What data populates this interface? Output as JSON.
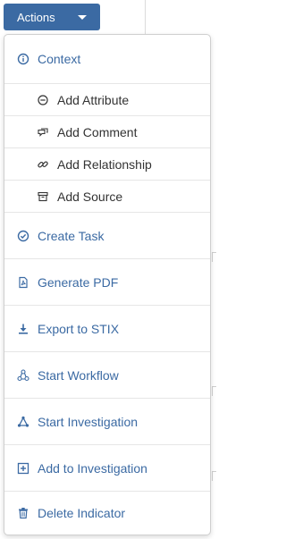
{
  "button": {
    "label": "Actions"
  },
  "menu": {
    "items": [
      {
        "label": "Context",
        "icon": "info-icon"
      },
      {
        "label": "Add Attribute",
        "icon": "minus-circle-icon"
      },
      {
        "label": "Add Comment",
        "icon": "comment-icon"
      },
      {
        "label": "Add Relationship",
        "icon": "link-icon"
      },
      {
        "label": "Add Source",
        "icon": "archive-icon"
      },
      {
        "label": "Create Task",
        "icon": "check-circle-icon"
      },
      {
        "label": "Generate PDF",
        "icon": "pdf-file-icon"
      },
      {
        "label": "Export to STIX",
        "icon": "download-icon"
      },
      {
        "label": "Start Workflow",
        "icon": "workflow-icon"
      },
      {
        "label": "Start Investigation",
        "icon": "network-icon"
      },
      {
        "label": "Add to Investigation",
        "icon": "plus-square-icon"
      },
      {
        "label": "Delete Indicator",
        "icon": "trash-icon"
      }
    ]
  },
  "colors": {
    "accent": "#3b6aa3",
    "text": "#333333",
    "divider": "#e6e6e6"
  }
}
